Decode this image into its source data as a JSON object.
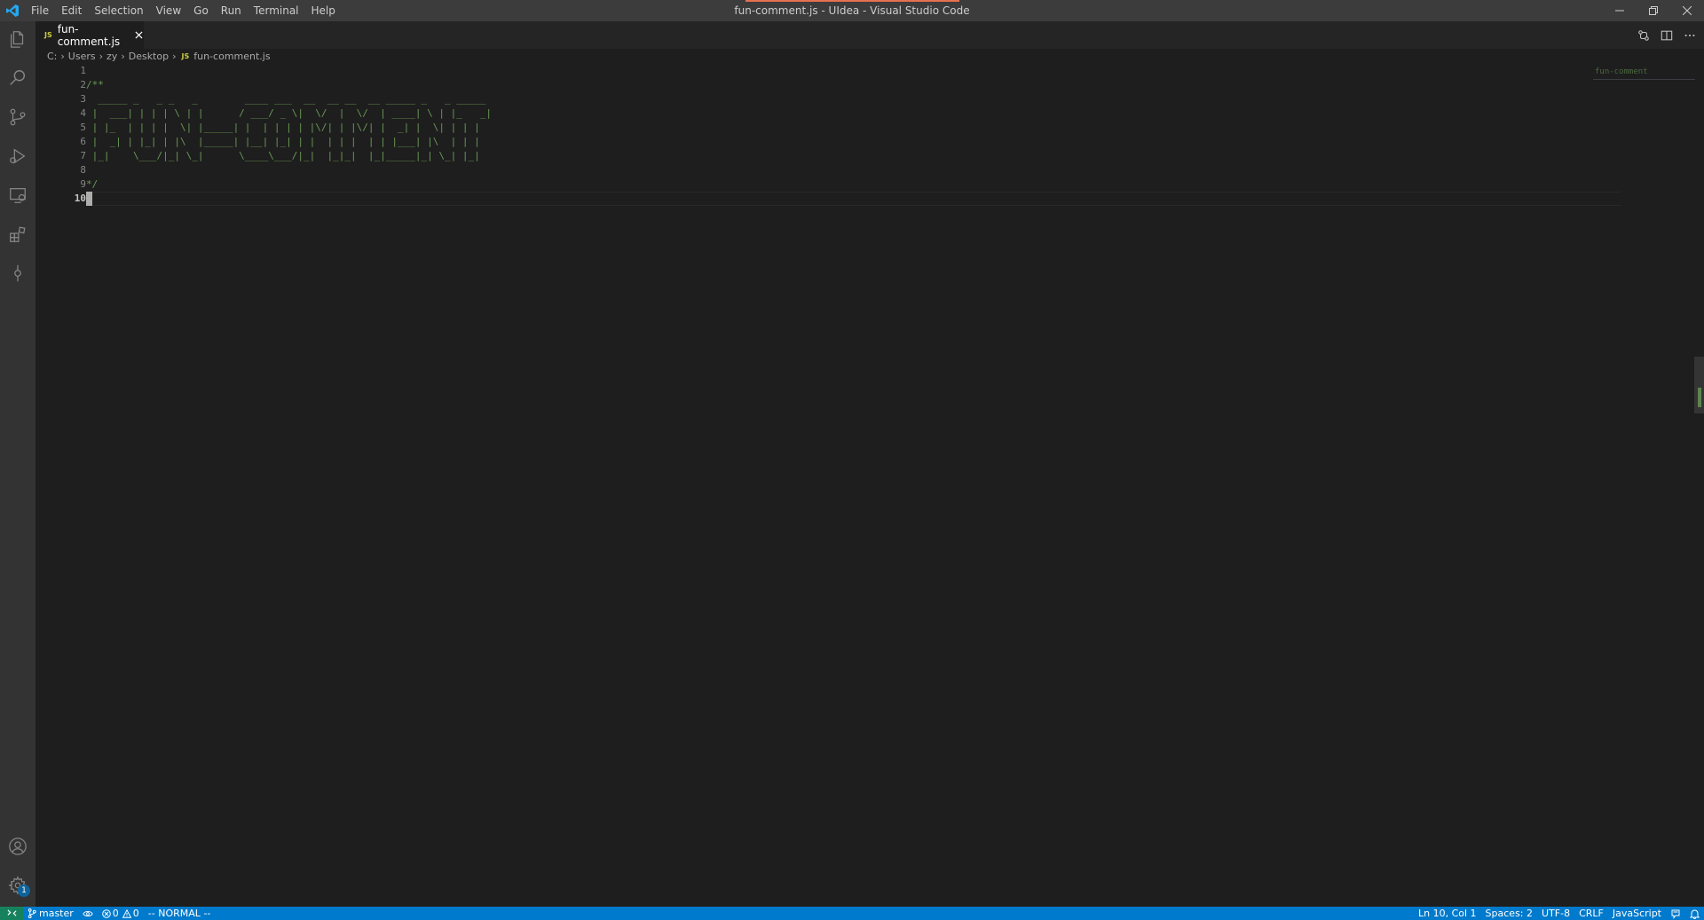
{
  "titlebar": {
    "menu": [
      "File",
      "Edit",
      "Selection",
      "View",
      "Go",
      "Run",
      "Terminal",
      "Help"
    ],
    "title": "fun-comment.js - UIdea - Visual Studio Code",
    "accent_color": "#e8704e"
  },
  "activitybar": {
    "icons": [
      "explorer-icon",
      "search-icon",
      "source-control-icon",
      "run-debug-icon",
      "remote-explorer-icon",
      "extensions-icon",
      "timeline-icon",
      "accounts-icon",
      "manage-gear-icon"
    ],
    "settings_badge": "1"
  },
  "tabs": [
    {
      "label": "fun-comment.js",
      "icon": "JS",
      "active": true
    }
  ],
  "breadcrumb": {
    "parts": [
      "C:",
      "Users",
      "zy",
      "Desktop"
    ],
    "file_icon": "JS",
    "file": "fun-comment.js"
  },
  "editor": {
    "line_numbers": [
      "1",
      "2",
      "3",
      "4",
      "5",
      "6",
      "7",
      "8",
      "9",
      "10"
    ],
    "active_line": "10",
    "lines": [
      "",
      "/**",
      "  _____ _   _ _   _        ____ ___  __  __ __  __ _____ _   _ _____",
      " |  ___| | | | \\ | |      / ___/ _ \\|  \\/  |  \\/  | ____| \\ | |_   _|",
      " | |_  | | | |  \\| |_____| |  | | | | |\\/| | |\\/| |  _| |  \\| | | |",
      " |  _| | |_| | |\\  |_____| |__| |_| | |  | | |  | | |___| |\\  | | |",
      " |_|    \\___/|_| \\_|      \\____\\___/|_|  |_|_|  |_|_____|_| \\_| |_|",
      "",
      "*/",
      ""
    ],
    "minimap_label": "fun-comment"
  },
  "statusbar": {
    "branch": "master",
    "errors": "0",
    "warnings": "0",
    "vim_mode": "-- NORMAL --",
    "position": "Ln 10, Col 1",
    "spaces": "Spaces: 2",
    "encoding": "UTF-8",
    "eol": "CRLF",
    "language": "JavaScript",
    "background_color": "#007acc",
    "remote_color": "#16825d"
  }
}
